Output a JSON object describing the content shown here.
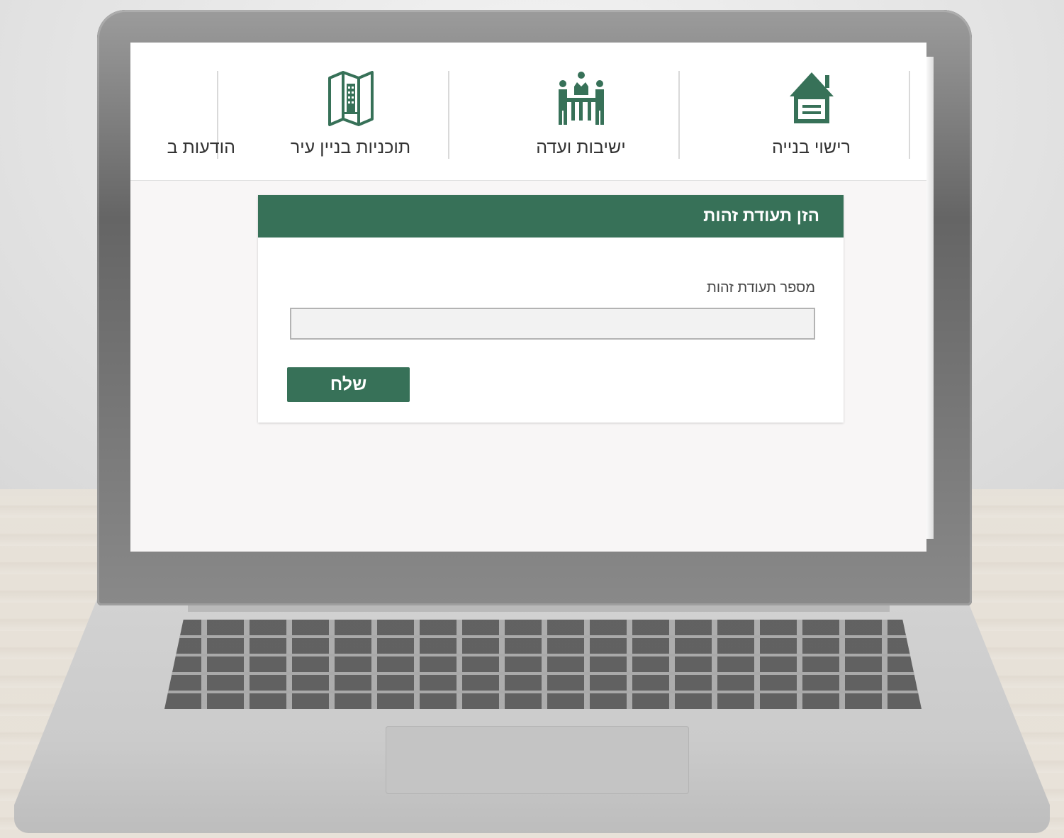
{
  "nav": {
    "items": [
      {
        "label": "רישוי בנייה",
        "icon": "house-icon"
      },
      {
        "label": "ישיבות ועדה",
        "icon": "committee-meeting-icon"
      },
      {
        "label": "תוכניות בניין עיר",
        "icon": "city-plan-map-icon"
      },
      {
        "label": "הודעות ב",
        "icon": ""
      }
    ]
  },
  "form": {
    "title": "הזן תעודת זהות",
    "id_label": "מספר תעודת זהות",
    "id_value": "",
    "submit_label": "שלח"
  },
  "colors": {
    "brand_green": "#377158",
    "nav_text": "#333333"
  }
}
